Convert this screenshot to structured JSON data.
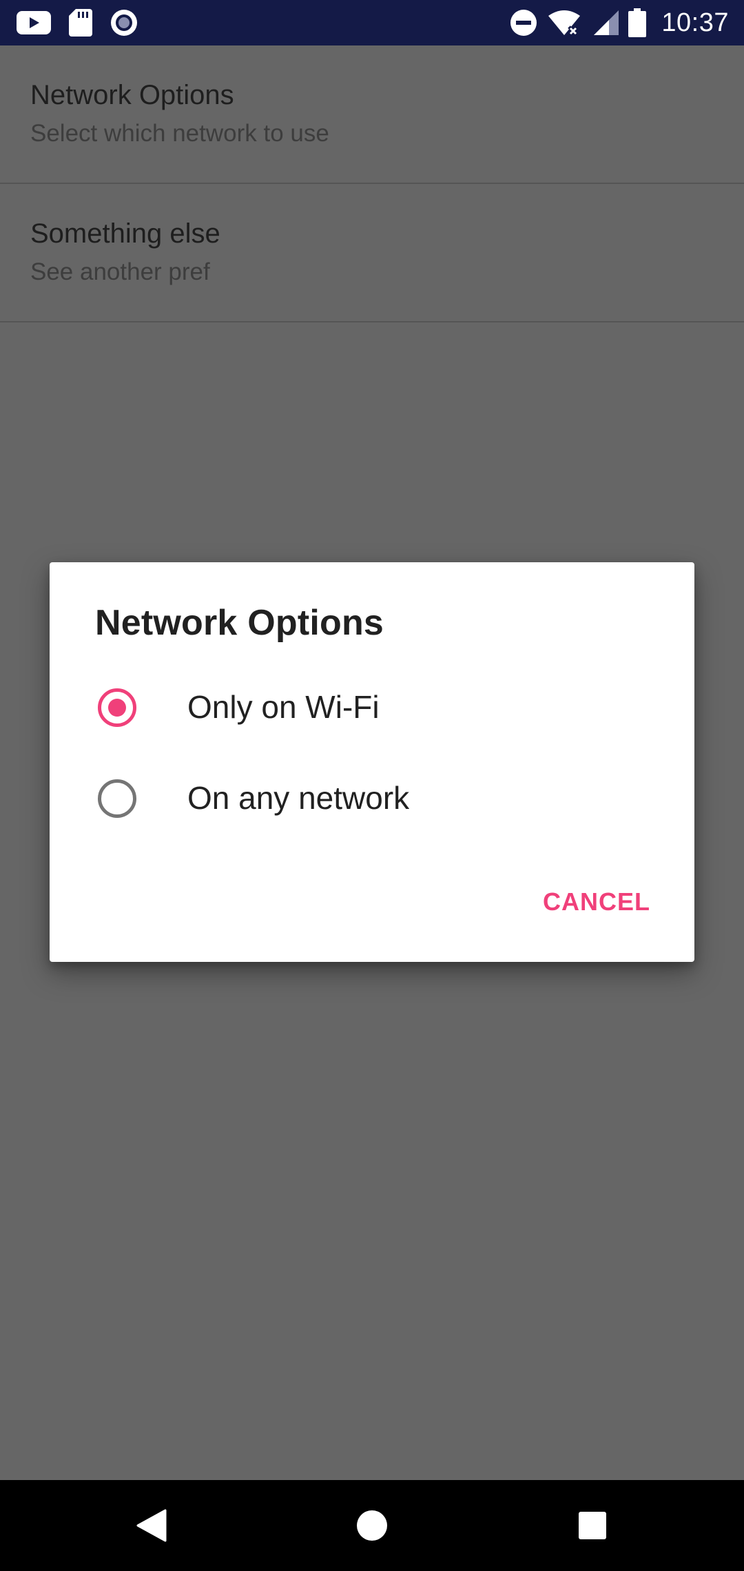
{
  "status_bar": {
    "time": "10:37",
    "icons": [
      "youtube-icon",
      "sd-card-icon",
      "record-icon",
      "do-not-disturb-icon",
      "wifi-icon",
      "cell-signal-icon",
      "battery-icon"
    ]
  },
  "preferences": [
    {
      "title": "Network Options",
      "summary": "Select which network to use"
    },
    {
      "title": "Something else",
      "summary": "See another pref"
    }
  ],
  "dialog": {
    "title": "Network Options",
    "options": [
      {
        "label": "Only on Wi-Fi",
        "checked": true
      },
      {
        "label": "On any network",
        "checked": false
      }
    ],
    "cancel_label": "CANCEL"
  },
  "colors": {
    "status_bar": "#141a47",
    "accent": "#f0407a",
    "scrim_background": "#666666",
    "dialog_background": "#ffffff"
  },
  "navigation": {
    "icons": [
      "back-icon",
      "home-icon",
      "recents-icon"
    ]
  }
}
